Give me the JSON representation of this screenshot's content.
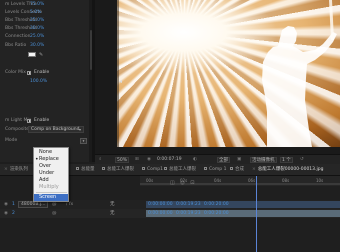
{
  "effect_controls": {
    "rows": [
      {
        "label": "m Levels Thre",
        "value": "75.0%"
      },
      {
        "label": "Levels Connecto",
        "value": "5.0%"
      },
      {
        "label": "Bbs Threshold",
        "value": "25.0%"
      },
      {
        "label": "Bbs Threshold",
        "value": "30.0%"
      },
      {
        "label": "Connection",
        "value": "25.0%"
      },
      {
        "label": "Bbs Ratio",
        "value": "30.0%"
      }
    ],
    "color_checkbox_label": "Color Mix",
    "color_checkbox_text": "Enable",
    "color_value": "100.0%",
    "light_mix_label": "m Light Mix",
    "light_mix_checkbox_text": "Enable",
    "composite_label": "Composite",
    "composite_value": "Comp on Background",
    "mode_label": "Mode"
  },
  "composite_menu": {
    "items": [
      "None",
      "Replace",
      "Over",
      "Under",
      "Add",
      "Multiply",
      "Screen"
    ],
    "selected": "Replace",
    "highlighted": "Screen"
  },
  "viewer_bar": {
    "zoom": "50%",
    "timecode": "0:00:07:19",
    "resolution": "全部",
    "camera": "活动摄像机",
    "views": "1 个"
  },
  "tabs": [
    {
      "label": "渲染队列"
    },
    {
      "label": "合成工作"
    },
    {
      "label": "总能量"
    },
    {
      "label": "总能工人爆裂"
    },
    {
      "label": "Comp1"
    },
    {
      "label": "总能工人爆裂"
    },
    {
      "label": "Comp 1"
    },
    {
      "label": "合成"
    },
    {
      "label": "总能工人爆裂00000-00013.jpg"
    }
  ],
  "timeline": {
    "ruler": [
      "00s",
      "02s",
      "04s",
      "06s",
      "08s",
      "10s"
    ],
    "rows": [
      {
        "num": "1",
        "name": "48000B.j...",
        "mode": "无",
        "in": "0:00:00:00",
        "out": "0:00:19:23",
        "dur": "0:00:20:00"
      },
      {
        "num": "2",
        "name": "",
        "mode": "无",
        "in": "0:00:00:00",
        "out": "0:00:19:23",
        "dur": "0:00:20:00"
      }
    ]
  },
  "colors": {
    "accent": "#4b8fd6",
    "menu_highlight": "#3d6fc4",
    "panel_bg": "#232323"
  }
}
